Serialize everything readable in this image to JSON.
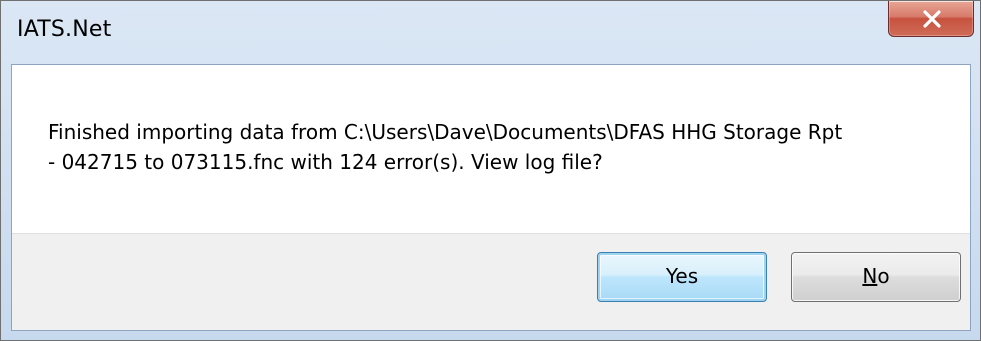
{
  "window": {
    "title": "IATS.Net"
  },
  "message": {
    "line1": "Finished importing data from C:\\Users\\Dave\\Documents\\DFAS HHG Storage Rpt",
    "line2": "- 042715 to 073115.fnc with 124 error(s).  View log file?"
  },
  "buttons": {
    "yes_label": "Yes",
    "no_mnemonic": "N",
    "no_rest": "o"
  },
  "icons": {
    "close": "close-icon"
  },
  "colors": {
    "close_button": "#c7523f",
    "default_button_border": "#3c7fb1",
    "frame": "#d5e2f1"
  }
}
